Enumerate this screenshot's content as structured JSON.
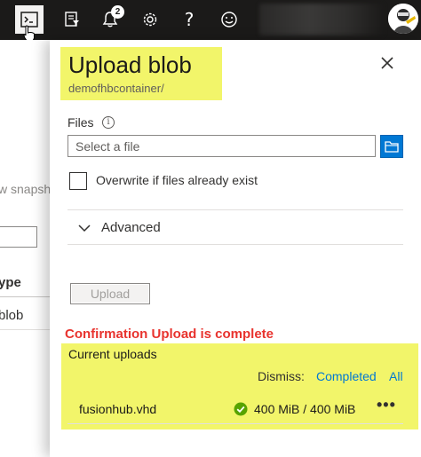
{
  "topbar": {
    "notifications_count": "2",
    "help_glyph": "?",
    "icons": [
      "cloud-shell-icon",
      "directory-filter-icon",
      "bell-icon",
      "gear-icon",
      "help-icon",
      "smiley-icon"
    ]
  },
  "background": {
    "snapshot_text": "w snapsh",
    "column_header": "ype",
    "row_text": "blob"
  },
  "panel": {
    "title": "Upload blob",
    "subtitle": "demofhbcontainer/",
    "files_label": "Files",
    "info_glyph": "i",
    "file_placeholder": "Select a file",
    "overwrite_label": "Overwrite if files already exist",
    "advanced_label": "Advanced",
    "upload_button": "Upload"
  },
  "annotation": {
    "confirmation_text": "Confirmation Upload is complete"
  },
  "uploads": {
    "header": "Current uploads",
    "dismiss_label": "Dismiss:",
    "dismiss_completed": "Completed",
    "dismiss_all": "All",
    "items": [
      {
        "name": "fusionhub.vhd",
        "status": "complete",
        "progress_text": "400 MiB / 400 MiB",
        "more_glyph": "•••"
      }
    ]
  },
  "colors": {
    "topbar": "#1b1a19",
    "accent": "#0078d4",
    "highlight": "#f2f56a",
    "confirm_red": "#e8332e",
    "success_green": "#57a300"
  }
}
